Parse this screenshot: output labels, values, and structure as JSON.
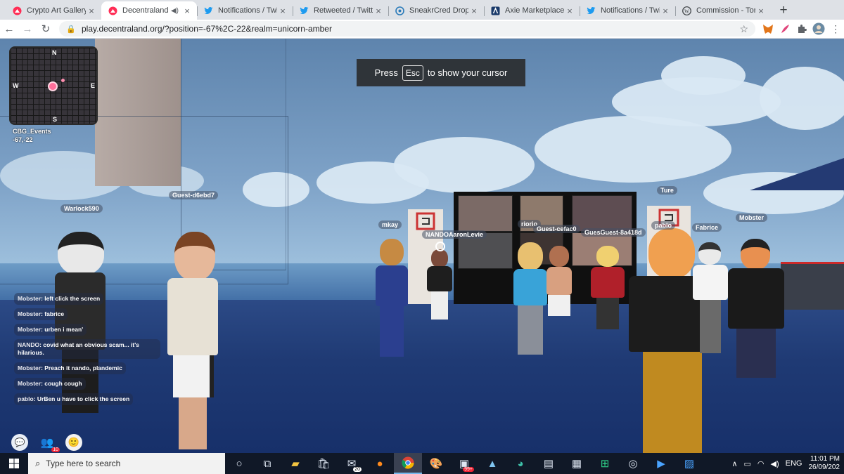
{
  "browser": {
    "tabs": [
      {
        "title": "Crypto Art Gallery",
        "icon": "decentraland-icon",
        "active": false
      },
      {
        "title": "Decentraland",
        "icon": "decentraland-icon",
        "active": true
      },
      {
        "title": "Notifications / Twi",
        "icon": "twitter-icon",
        "active": false
      },
      {
        "title": "Retweeted / Twitte",
        "icon": "twitter-icon",
        "active": false
      },
      {
        "title": "SneakrCred Drop",
        "icon": "sneakrcred-icon",
        "active": false
      },
      {
        "title": "Axie Marketplace",
        "icon": "axie-icon",
        "active": false
      },
      {
        "title": "Notifications / Twi",
        "icon": "twitter-icon",
        "active": false
      },
      {
        "title": "Commission - Ton",
        "icon": "wordpress-icon",
        "active": false
      }
    ],
    "url": "play.decentraland.org/?position=-67%2C-22&realm=unicorn-amber"
  },
  "overlay": {
    "esc_prefix": "Press",
    "esc_key": "Esc",
    "esc_suffix": "to show your cursor"
  },
  "minimap": {
    "north": "N",
    "south": "S",
    "east": "E",
    "west": "W",
    "scene_name": "CBG_Events",
    "coords": "-67,-22"
  },
  "nametags": [
    "Warlock590",
    "Guest-d6ebd7",
    "mkay",
    "NANDOAaronLevie",
    "riorio",
    "Guest-cefac0",
    "GuesGuest-8a418d",
    "Ture",
    "pablo",
    "Fabrice",
    "Mobster"
  ],
  "chat": [
    {
      "user": "Mobster",
      "text": "left click the screen"
    },
    {
      "user": "Mobster",
      "text": "fabrice"
    },
    {
      "user": "Mobster",
      "text": "urben i mean'"
    },
    {
      "user": "NANDO",
      "text": "covid what an obvious scam... it's hilarious."
    },
    {
      "user": "Mobster",
      "text": "Preach it nando, plandemic"
    },
    {
      "user": "Mobster",
      "text": "cough cough"
    },
    {
      "user": "pablo",
      "text": "UrBen u have to click the screen"
    }
  ],
  "hud": {
    "friends_badge": "10"
  },
  "taskbar": {
    "search_placeholder": "Type here to search",
    "mail_badge": "20",
    "app_badge": "99+",
    "language": "ENG",
    "time": "11:01 PM",
    "date": "26/09/202"
  },
  "colors": {
    "sky": "#7fa3c8",
    "floor": "#1f3a74",
    "taskbar": "#101827"
  }
}
